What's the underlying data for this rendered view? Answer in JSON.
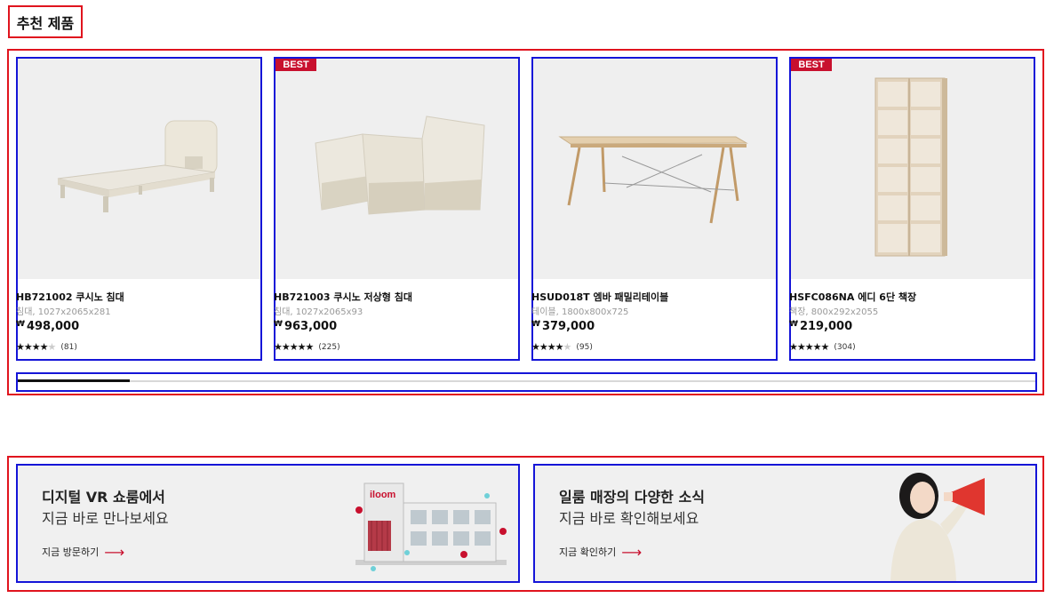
{
  "section": {
    "title": "추천 제품"
  },
  "products": [
    {
      "badge": "",
      "name": "HB721002 쿠시노 침대",
      "spec": "침대, 1027x2065x281",
      "currency": "₩",
      "price": "498,000",
      "rating": 4,
      "review_count": "(81)"
    },
    {
      "badge": "BEST",
      "name": "HB721003 쿠시노 저상형 침대",
      "spec": "침대, 1027x2065x93",
      "currency": "₩",
      "price": "963,000",
      "rating": 5,
      "review_count": "(225)"
    },
    {
      "badge": "",
      "name": "HSUD018T 엠바 패밀리테이블",
      "spec": "테이블, 1800x800x725",
      "currency": "₩",
      "price": "379,000",
      "rating": 4,
      "review_count": "(95)"
    },
    {
      "badge": "BEST",
      "name": "HSFC086NA 에디 6단 책장",
      "spec": "책장, 800x292x2055",
      "currency": "₩",
      "price": "219,000",
      "rating": 5,
      "review_count": "(304)"
    }
  ],
  "scrollbar": {
    "progress": 0.11
  },
  "banners": [
    {
      "title": "디지털 VR 쇼룸에서",
      "subtitle": "지금 바로 만나보세요",
      "link": "지금 방문하기",
      "illustration_logo": "iloom"
    },
    {
      "title": "일룸 매장의 다양한 소식",
      "subtitle": "지금 바로 확인해보세요",
      "link": "지금 확인하기"
    }
  ],
  "colors": {
    "badge": "#c8102e",
    "accent": "#c8102e",
    "card_bg": "#efefef",
    "banner_bg": "#f0f0f0"
  }
}
